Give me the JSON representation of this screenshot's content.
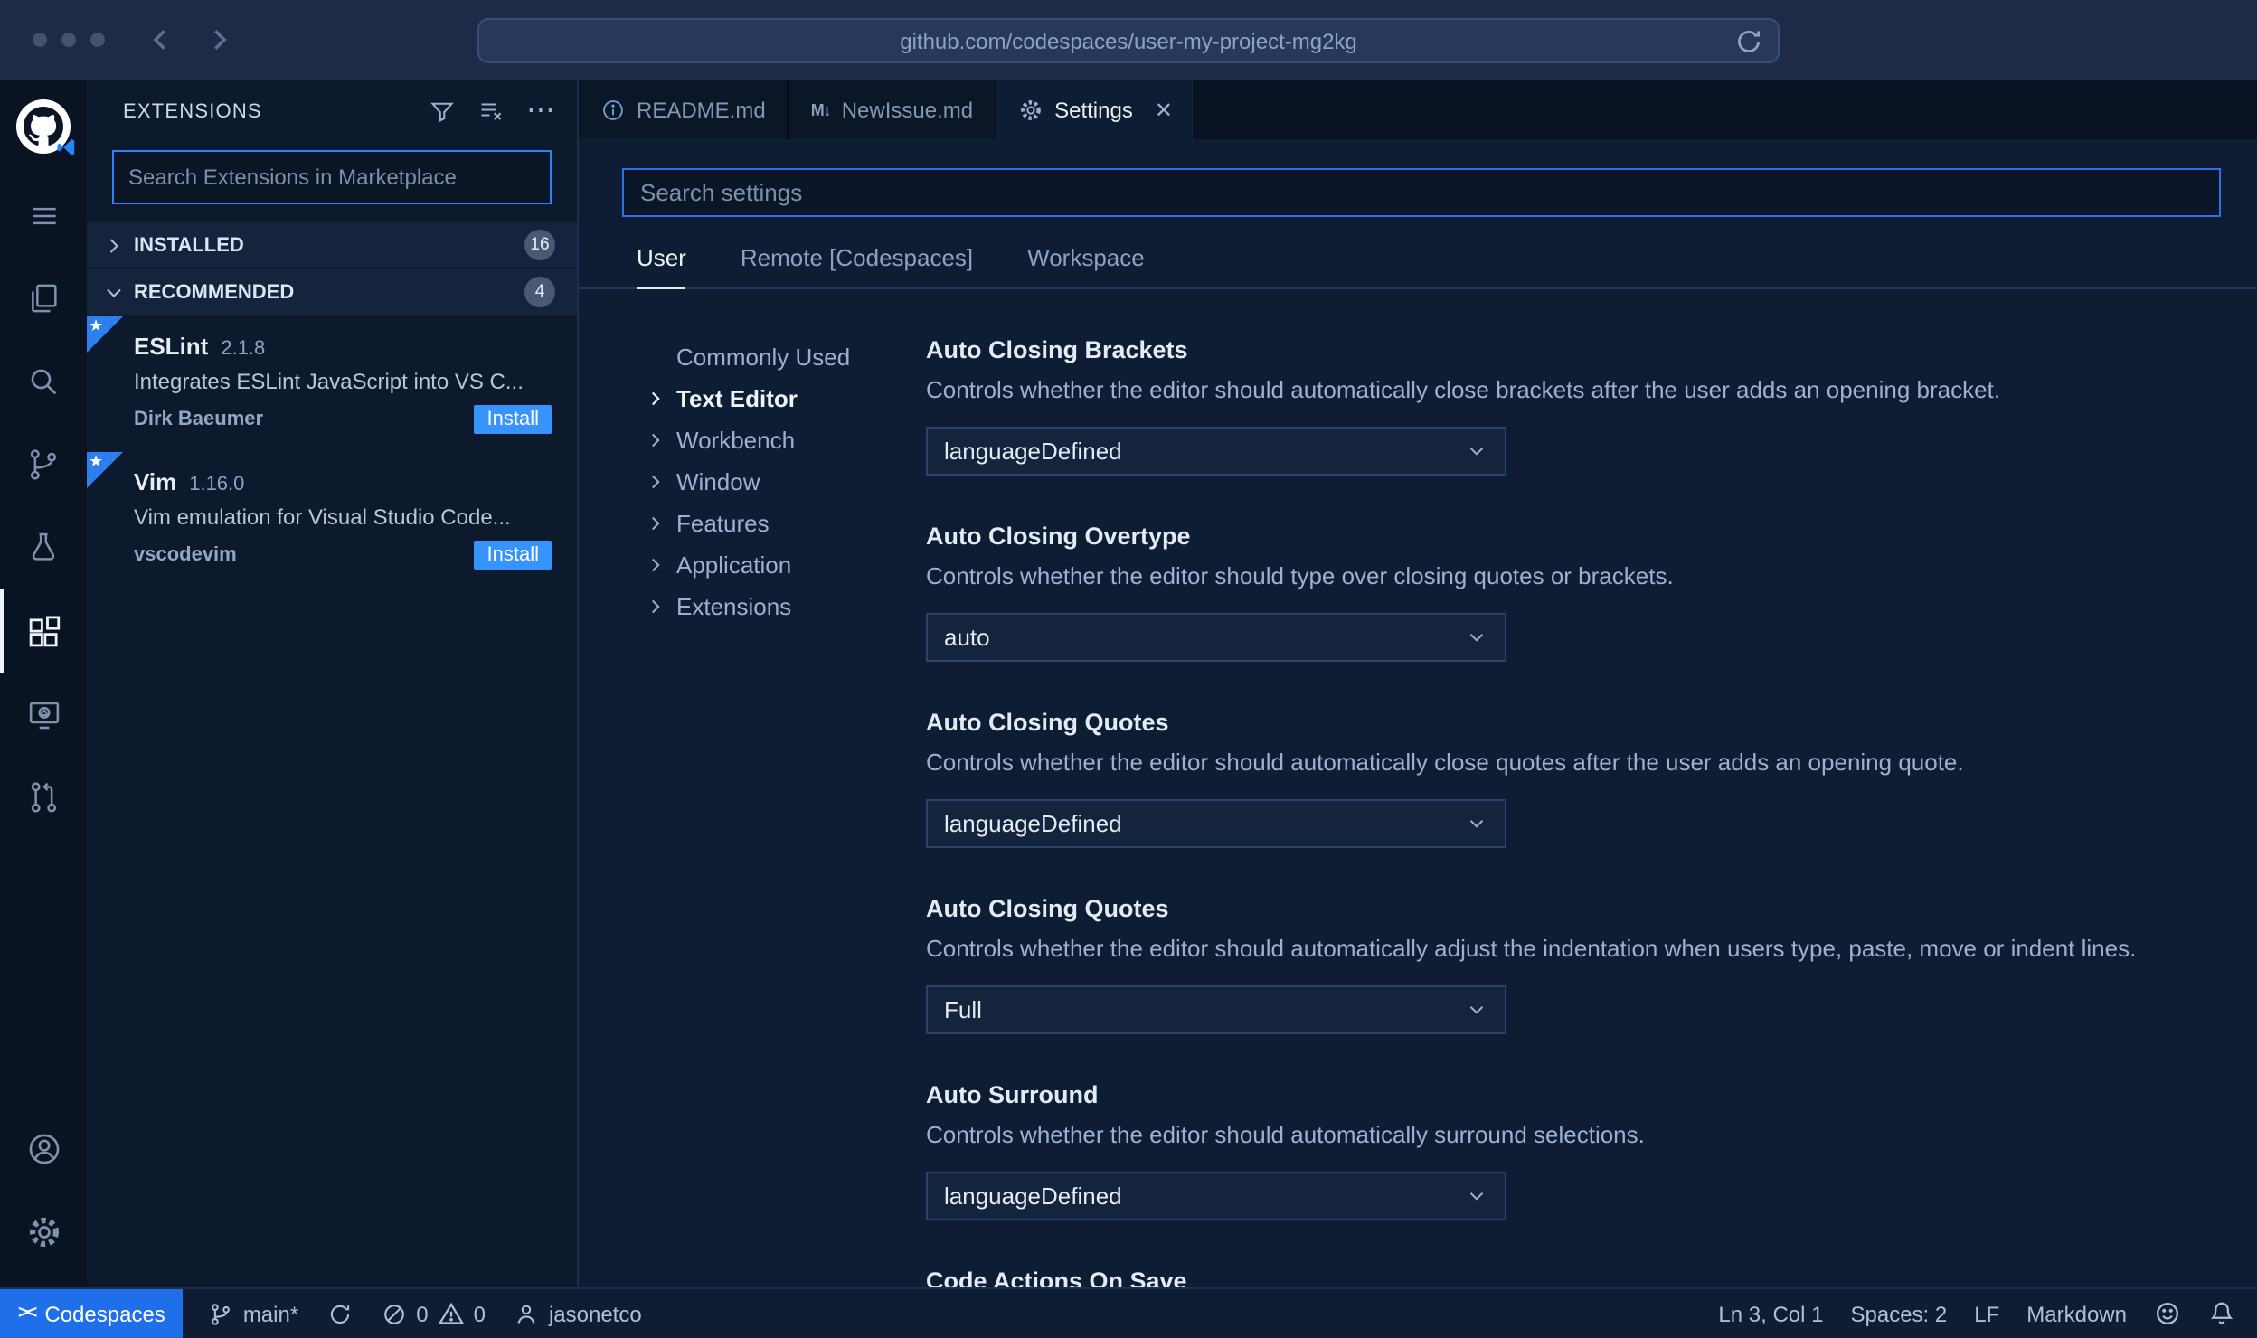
{
  "browser": {
    "url": "github.com/codespaces/user-my-project-mg2kg"
  },
  "activity_bar": {
    "icons": [
      "github-logo",
      "menu",
      "explorer",
      "search",
      "source-control",
      "run-debug",
      "extensions",
      "remote-explorer",
      "pull-requests",
      "account",
      "settings-gear"
    ],
    "active": "extensions"
  },
  "sidebar": {
    "title": "EXTENSIONS",
    "search_placeholder": "Search Extensions in Marketplace",
    "sections": [
      {
        "label": "INSTALLED",
        "count": "16"
      },
      {
        "label": "RECOMMENDED",
        "count": "4"
      }
    ],
    "extensions": [
      {
        "name": "ESLint",
        "version": "2.1.8",
        "description": "Integrates ESLint JavaScript into VS C...",
        "publisher": "Dirk Baeumer",
        "action": "Install"
      },
      {
        "name": "Vim",
        "version": "1.16.0",
        "description": "Vim emulation for Visual Studio Code...",
        "publisher": "vscodevim",
        "action": "Install"
      }
    ]
  },
  "tabs": [
    {
      "label": "README.md"
    },
    {
      "label": "NewIssue.md"
    },
    {
      "label": "Settings",
      "close": "✕"
    }
  ],
  "settings": {
    "search_placeholder": "Search settings",
    "scopes": [
      {
        "label": "User"
      },
      {
        "label": "Remote [Codespaces]"
      },
      {
        "label": "Workspace"
      }
    ],
    "toc": [
      {
        "label": "Commonly Used"
      },
      {
        "label": "Text Editor"
      },
      {
        "label": "Workbench"
      },
      {
        "label": "Window"
      },
      {
        "label": "Features"
      },
      {
        "label": "Application"
      },
      {
        "label": "Extensions"
      }
    ],
    "items": [
      {
        "title": "Auto Closing Brackets",
        "description": "Controls whether the editor should automatically close brackets after the user adds an opening bracket.",
        "value": "languageDefined"
      },
      {
        "title": "Auto Closing Overtype",
        "description": "Controls whether the editor should type over closing quotes or brackets.",
        "value": "auto"
      },
      {
        "title": "Auto Closing Quotes",
        "description": "Controls whether the editor should automatically close quotes after the user adds an opening quote.",
        "value": "languageDefined"
      },
      {
        "title": "Auto Closing Quotes",
        "description": "Controls whether the editor should automatically adjust the indentation when users type, paste, move or indent lines.",
        "value": "Full"
      },
      {
        "title": "Auto Surround",
        "description": "Controls whether the editor should automatically surround selections.",
        "value": "languageDefined"
      },
      {
        "title": "Code Actions On Save",
        "description": "",
        "value": ""
      }
    ]
  },
  "status_bar": {
    "codespaces": "Codespaces",
    "branch": "main*",
    "errors": "0",
    "warnings": "0",
    "user": "jasonetco",
    "line_col": "Ln 3, Col 1",
    "indent": "Spaces: 2",
    "eol": "LF",
    "language": "Markdown"
  },
  "colors": {
    "accent": "#2f81f7",
    "install_button": "#3794ff",
    "codespaces_blue": "#1f6feb"
  }
}
